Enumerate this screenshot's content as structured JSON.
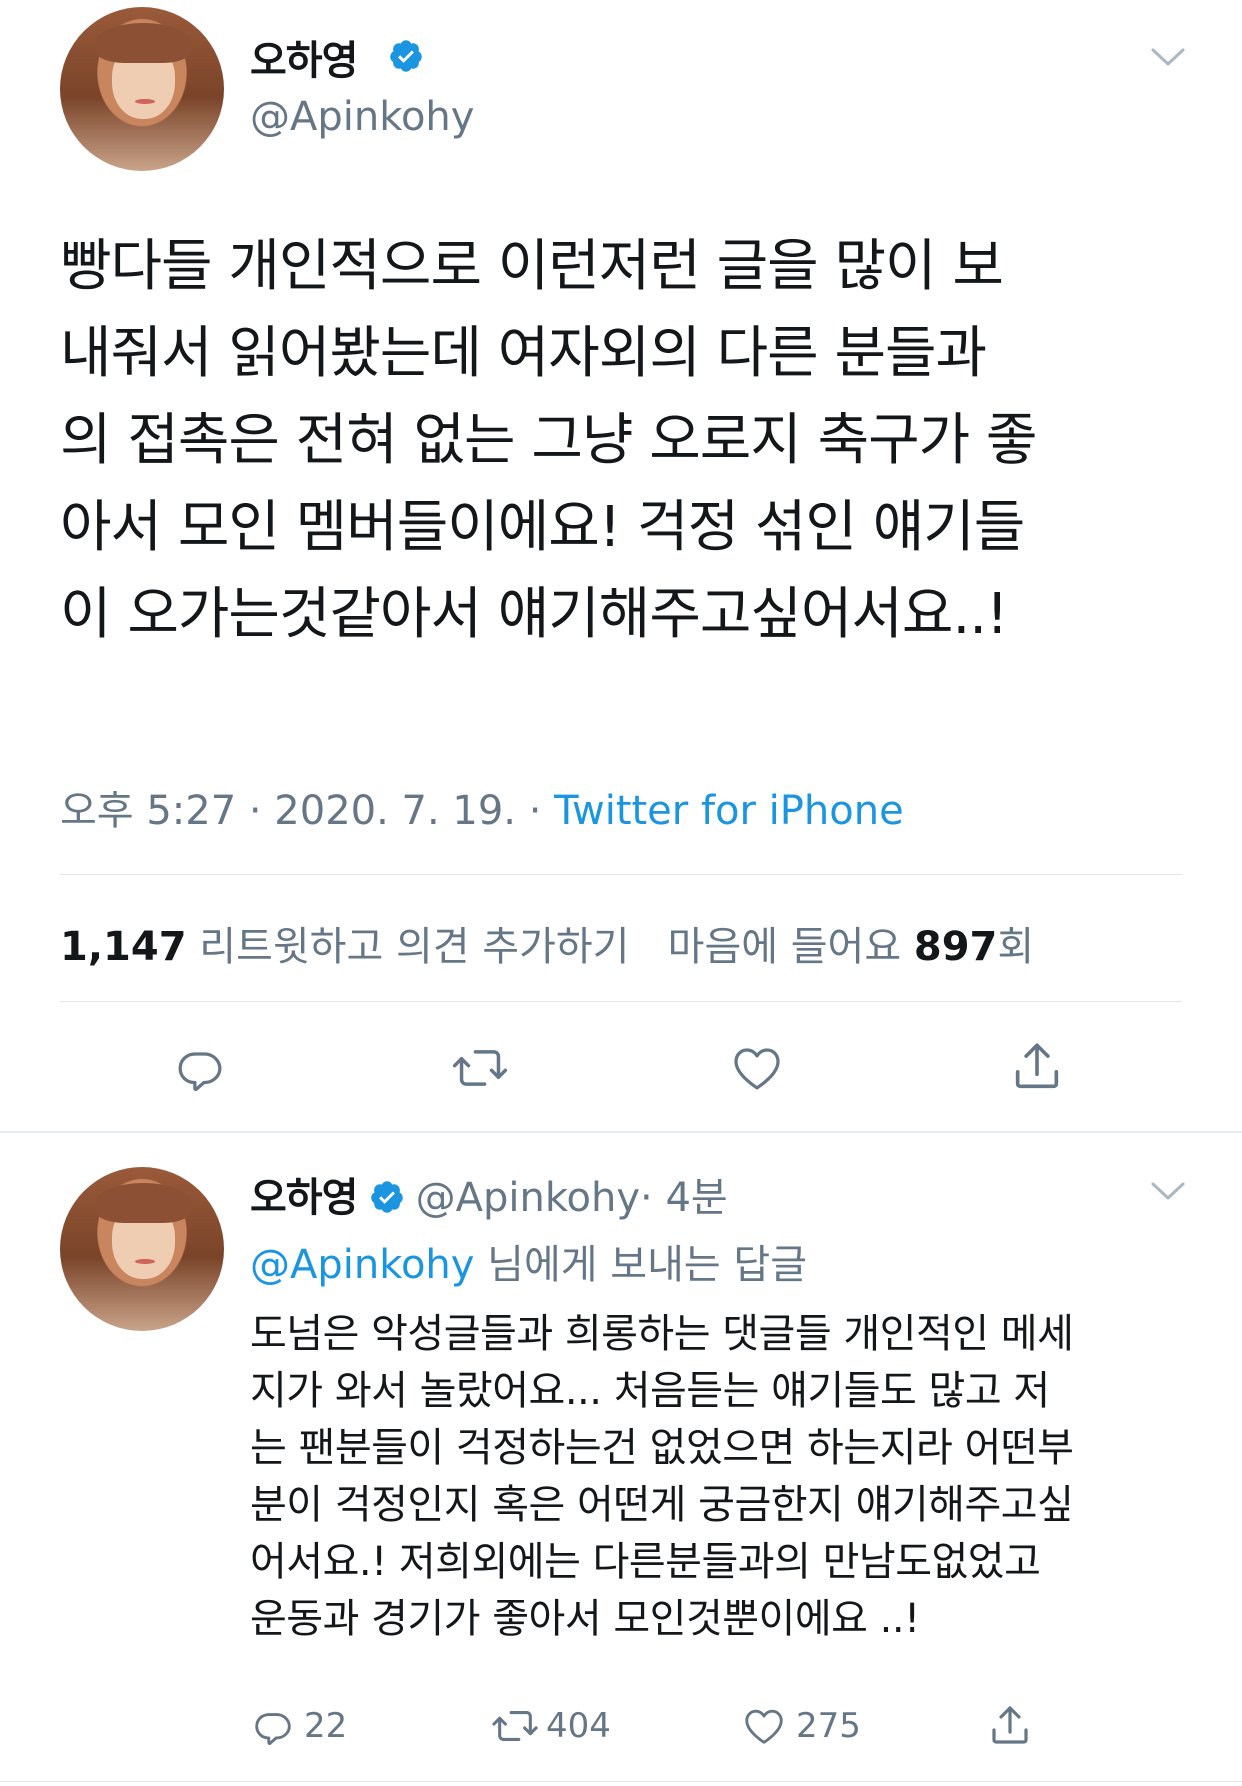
{
  "main_tweet": {
    "author_name": "오하영",
    "author_handle": "@Apinkohy",
    "text_lines": [
      "빵다들 개인적으로 이런저런 글을 많이 보",
      "내줘서 읽어봤는데 여자외의 다른 분들과",
      "의 접촉은 전혀 없는 그냥 오로지 축구가 좋",
      "아서 모인 멤버들이에요! 걱정 섞인 얘기들",
      "이 오가는것같아서 얘기해주고싶어서요..!"
    ],
    "time": "오후 5:27",
    "date": "2020. 7. 19.",
    "separator": "·",
    "source": "Twitter for iPhone",
    "retweet_count": "1,147",
    "retweet_label": "리트윗하고 의견 추가하기",
    "like_label": "마음에 들어요",
    "like_count": "897",
    "like_suffix": "회"
  },
  "reply_tweet": {
    "author_name": "오하영",
    "author_handle": "@Apinkohy",
    "time_ago": "· 4분",
    "replying_to_handle": "@Apinkohy",
    "replying_to_label": "님에게 보내는 답글",
    "text_lines": [
      "도넘은 악성글들과 희롱하는 댓글들 개인적인 메세",
      "지가 와서 놀랐어요... 처음듣는 얘기들도 많고 저",
      "는 팬분들이 걱정하는건 없었으면 하는지라 어떤부",
      "분이 걱정인지 혹은 어떤게 궁금한지 얘기해주고싶",
      "어서요.! 저희외에는 다른분들과의 만남도없었고",
      "운동과 경기가 좋아서 모인것뿐이에요 ..!"
    ],
    "reply_count": "22",
    "retweet_count": "404",
    "like_count": "275"
  },
  "colors": {
    "accent": "#1b95e0",
    "muted": "#657786",
    "text": "#14171a",
    "divider": "#e1e8ed"
  },
  "icons": [
    "verified-badge-icon",
    "chevron-down-icon",
    "reply-icon",
    "retweet-icon",
    "heart-icon",
    "share-icon"
  ]
}
